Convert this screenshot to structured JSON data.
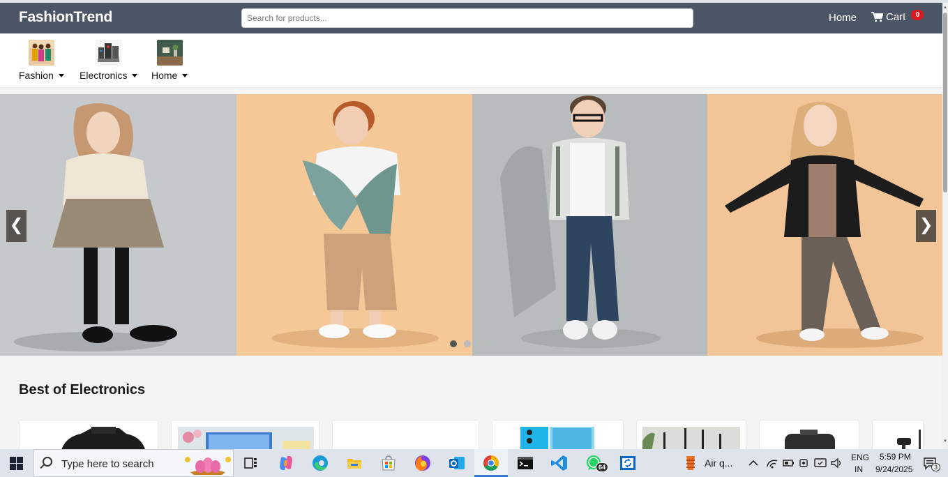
{
  "navbar": {
    "brand": "FashionTrend",
    "search_placeholder": "Search for products...",
    "home_label": "Home",
    "cart_label": "Cart",
    "cart_count": "0"
  },
  "categories": [
    {
      "label": "Fashion",
      "icon": "fashion-thumbnail"
    },
    {
      "label": "Electronics",
      "icon": "electronics-thumbnail"
    },
    {
      "label": "Home",
      "icon": "home-decor-thumbnail"
    }
  ],
  "carousel": {
    "prev_label": "❮",
    "next_label": "❯",
    "dots": 3,
    "active_dot": 0
  },
  "section": {
    "title": "Best of Electronics",
    "products": [
      "camera",
      "laptop",
      "blank",
      "smartphone",
      "router",
      "charger",
      "webcam"
    ]
  },
  "taskbar": {
    "search_text": "Type here to search",
    "weather": "Air q...",
    "lang_top": "ENG",
    "lang_bottom": "IN",
    "time": "5:59 PM",
    "date": "9/24/2025",
    "whatsapp_badge": "64",
    "notification_count": "3"
  },
  "colors": {
    "navbar_bg": "#4b5565",
    "cart_badge": "#e0161e",
    "accent": "#3a7bd5"
  }
}
